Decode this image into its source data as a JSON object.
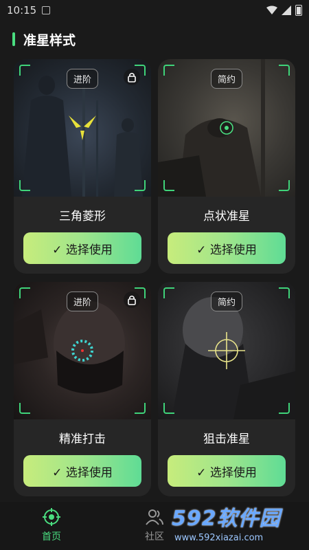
{
  "status_bar": {
    "time": "10:15"
  },
  "section": {
    "title": "准星样式"
  },
  "cards": [
    {
      "tag": "进阶",
      "locked": true,
      "name": "三角菱形",
      "button": "✓ 选择使用",
      "reticle_icon": "triangle-crosshair-icon"
    },
    {
      "tag": "简约",
      "locked": false,
      "name": "点状准星",
      "button": "✓ 选择使用",
      "reticle_icon": "dot-crosshair-icon"
    },
    {
      "tag": "进阶",
      "locked": true,
      "name": "精准打击",
      "button": "✓ 选择使用",
      "reticle_icon": "dashed-ring-crosshair-icon"
    },
    {
      "tag": "简约",
      "locked": false,
      "name": "狙击准星",
      "button": "✓ 选择使用",
      "reticle_icon": "sniper-crosshair-icon"
    }
  ],
  "tabs": [
    {
      "label": "首页",
      "icon": "crosshair-home-icon",
      "active": true
    },
    {
      "label": "社区",
      "icon": "users-icon",
      "active": false
    }
  ],
  "watermark": {
    "brand": "592软件园",
    "url": "www.592xiazai.com"
  },
  "colors": {
    "accent": "#4ade80",
    "card_bg": "#262626",
    "page_bg": "#1a1a1a",
    "button_start": "#c7ec7c",
    "button_end": "#5fdc95"
  }
}
